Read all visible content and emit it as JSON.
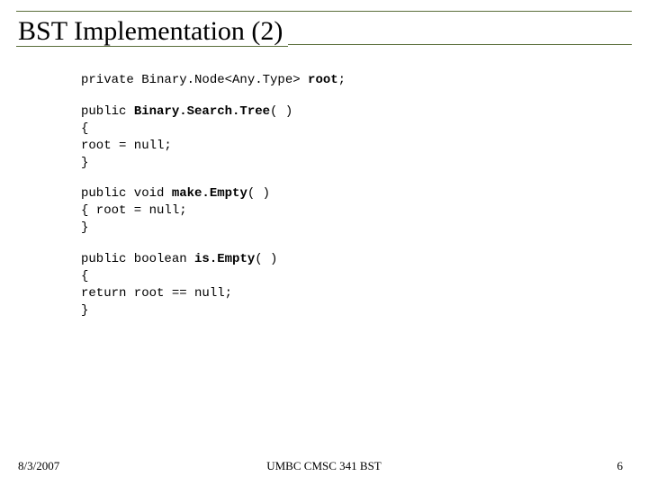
{
  "title": "BST Implementation (2)",
  "code": {
    "line1_a": "private Binary.Node<Any.Type> ",
    "line1_b": "root",
    "line1_c": ";",
    "block2_a": "public ",
    "block2_b": "Binary.Search.Tree",
    "block2_c": "( )",
    "block2_l2": "{",
    "block2_l3": "root = null;",
    "block2_l4": "}",
    "block3_a": "public void ",
    "block3_b": "make.Empty",
    "block3_c": "( )",
    "block3_l2": "{ root = null;",
    "block3_l3": "}",
    "block4_a": "public boolean ",
    "block4_b": "is.Empty",
    "block4_c": "( )",
    "block4_l2": "{",
    "block4_l3": "return root == null;",
    "block4_l4": "}"
  },
  "footer": {
    "date": "8/3/2007",
    "center": "UMBC CMSC 341 BST",
    "page": "6"
  }
}
